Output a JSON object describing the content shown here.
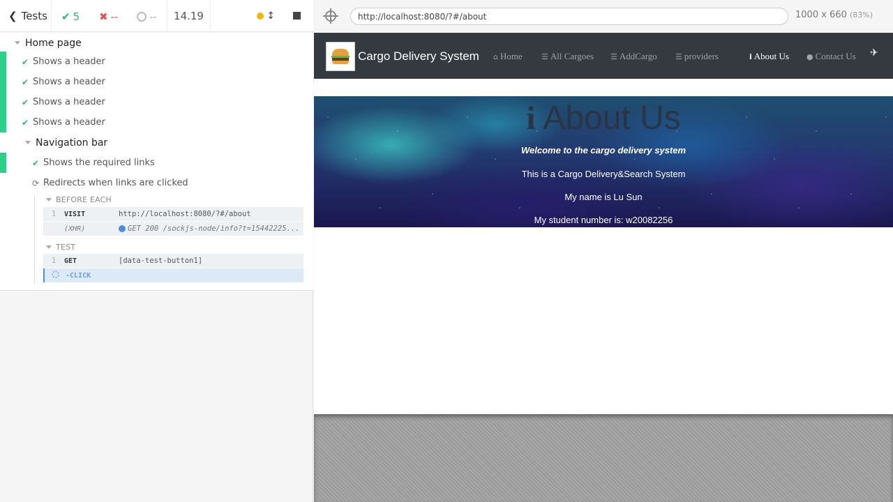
{
  "reporter": {
    "header": {
      "tests_label": "Tests",
      "passed": "5",
      "failed": "--",
      "pending": "--",
      "duration": "14.19"
    },
    "tree": {
      "suite_home": "Home page",
      "tests_home": [
        "Shows a header",
        "Shows a header",
        "Shows a header",
        "Shows a header"
      ],
      "suite_nav": "Navigation bar",
      "test_links": "Shows the required links",
      "test_redirect": "Redirects when links are clicked"
    },
    "commands": {
      "before_each": "BEFORE EACH",
      "visit_num": "1",
      "visit_name": "VISIT",
      "visit_msg": "http://localhost:8080/?#/about",
      "xhr_name": "(XHR)",
      "xhr_msg": "GET 200 /sockjs-node/info?t=15442225...",
      "test_label": "TEST",
      "get_num": "1",
      "get_name": "GET",
      "get_msg": "[data-test-button1]",
      "click_name": "-CLICK"
    }
  },
  "runner": {
    "url": "http://localhost:8080/?#/about",
    "viewport": "1000 x 660",
    "scale": "(83%)"
  },
  "app": {
    "brand": "Cargo Delivery System",
    "nav": {
      "home": "Home",
      "all_cargoes": "All Cargoes",
      "add_cargo": "AddCargo",
      "providers": "providers",
      "about": "About Us",
      "contact": "Contact Us"
    },
    "hero": {
      "title": "About Us",
      "welcome": "Welcome to the cargo delivery system",
      "line1": "This is a Cargo Delivery&Search System",
      "line2": "My name is Lu Sun",
      "line3": "My student number is: w20082256"
    }
  }
}
